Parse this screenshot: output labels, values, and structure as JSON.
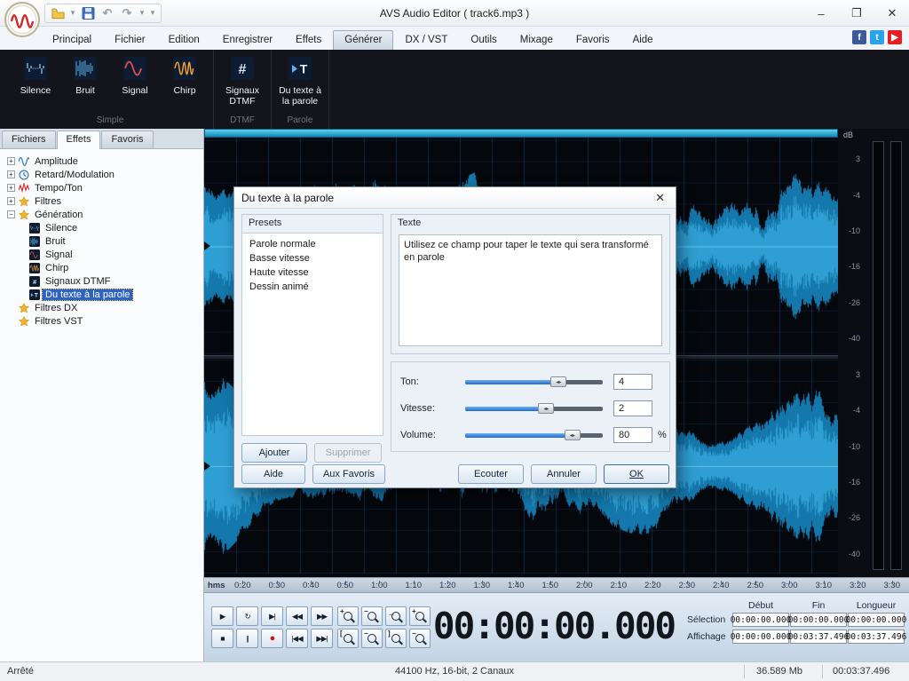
{
  "window": {
    "title": "AVS Audio Editor  ( track6.mp3 )",
    "minimize": "–",
    "maximize": "❐",
    "close": "✕"
  },
  "quick_access": [
    {
      "name": "open-file",
      "icon": "folder"
    },
    {
      "name": "open-file-dropdown",
      "icon": "chevron"
    },
    {
      "name": "save",
      "icon": "floppy"
    },
    {
      "name": "undo",
      "icon": "undo"
    },
    {
      "name": "redo",
      "icon": "redo"
    },
    {
      "name": "redo-dropdown",
      "icon": "chevron"
    },
    {
      "name": "customize-toolbar",
      "icon": "chevron"
    }
  ],
  "ribbon": {
    "tabs": [
      "Principal",
      "Fichier",
      "Edition",
      "Enregistrer",
      "Effets",
      "Générer",
      "DX / VST",
      "Outils",
      "Mixage",
      "Favoris",
      "Aide"
    ],
    "active_tab": "Générer",
    "groups": [
      {
        "label": "Simple",
        "buttons": [
          {
            "label": "Silence",
            "icon": "silence"
          },
          {
            "label": "Bruit",
            "icon": "noise"
          },
          {
            "label": "Signal",
            "icon": "signal"
          },
          {
            "label": "Chirp",
            "icon": "chirp"
          }
        ]
      },
      {
        "label": "DTMF",
        "buttons": [
          {
            "label": "Signaux DTMF",
            "icon": "dtmf"
          }
        ]
      },
      {
        "label": "Parole",
        "buttons": [
          {
            "label": "Du texte à la parole",
            "icon": "tts"
          }
        ]
      }
    ]
  },
  "social": [
    {
      "name": "facebook",
      "glyph": "f",
      "color": "#3a5a98"
    },
    {
      "name": "twitter",
      "glyph": "t",
      "color": "#2aa3ef"
    },
    {
      "name": "youtube",
      "glyph": "▶",
      "color": "#e32020"
    }
  ],
  "left_panel": {
    "tabs": [
      "Fichiers",
      "Effets",
      "Favoris"
    ],
    "active_tab": "Effets",
    "tree": [
      {
        "label": "Amplitude",
        "icon": "amp",
        "expand": "+"
      },
      {
        "label": "Retard/Modulation",
        "icon": "clock",
        "expand": "+"
      },
      {
        "label": "Tempo/Ton",
        "icon": "tempo",
        "expand": "+"
      },
      {
        "label": "Filtres",
        "icon": "star",
        "expand": "+"
      },
      {
        "label": "Génération",
        "icon": "star",
        "expand": "−",
        "children": [
          {
            "label": "Silence",
            "icon": "silence"
          },
          {
            "label": "Bruit",
            "icon": "noise"
          },
          {
            "label": "Signal",
            "icon": "signal"
          },
          {
            "label": "Chirp",
            "icon": "chirp"
          },
          {
            "label": "Signaux DTMF",
            "icon": "dtmf"
          },
          {
            "label": "Du texte à la parole",
            "icon": "tts",
            "selected": true
          }
        ]
      },
      {
        "label": "Filtres DX",
        "icon": "star"
      },
      {
        "label": "Filtres VST",
        "icon": "star"
      }
    ]
  },
  "dialog": {
    "title": "Du texte à la parole",
    "close": "✕",
    "presets_label": "Presets",
    "presets": [
      "Parole normale",
      "Basse vitesse",
      "Haute vitesse",
      "Dessin animé"
    ],
    "add_button": "Ajouter",
    "remove_button": "Supprimer",
    "text_group_label": "Texte",
    "text_value": "Utilisez ce champ pour taper le texte qui sera transformé en parole",
    "sliders": [
      {
        "label": "Ton:",
        "value": "4",
        "percent": 68
      },
      {
        "label": "Vitesse:",
        "value": "2",
        "percent": 59
      },
      {
        "label": "Volume:",
        "value": "80",
        "percent": 78,
        "suffix": "%"
      }
    ],
    "help_button": "Aide",
    "favorites_button": "Aux Favoris",
    "listen_button": "Ecouter",
    "cancel_button": "Annuler",
    "ok_button": "OK"
  },
  "meters": {
    "db": "dB",
    "scale_sections": [
      [
        "3",
        "-4",
        "-10",
        "-16",
        "-26",
        "-40"
      ],
      [
        "3",
        "-4",
        "-10",
        "-16",
        "-26",
        "-40"
      ]
    ]
  },
  "timeline": {
    "unit": "hms",
    "ticks": [
      "0:20",
      "0:30",
      "0:40",
      "0:50",
      "1:00",
      "1:10",
      "1:20",
      "1:30",
      "1:40",
      "1:50",
      "2:00",
      "2:10",
      "2:20",
      "2:30",
      "2:40",
      "2:50",
      "3:00",
      "3:10",
      "3:20",
      "3:30"
    ]
  },
  "transport": [
    [
      {
        "name": "play",
        "glyph": "▶"
      },
      {
        "name": "loop",
        "glyph": "↻"
      },
      {
        "name": "play-to-end",
        "glyph": "▶|"
      },
      {
        "name": "rewind",
        "glyph": "◀◀"
      },
      {
        "name": "fast-forward",
        "glyph": "▶▶"
      }
    ],
    [
      {
        "name": "stop",
        "glyph": "■"
      },
      {
        "name": "pause",
        "glyph": "||"
      },
      {
        "name": "record",
        "glyph": "●",
        "record": true
      },
      {
        "name": "go-to-start",
        "glyph": "|◀◀"
      },
      {
        "name": "go-to-end",
        "glyph": "▶▶|"
      }
    ]
  ],
  "zoom": [
    [
      {
        "name": "zoom-in",
        "mod": "+"
      },
      {
        "name": "zoom-out",
        "mod": "−"
      },
      {
        "name": "zoom-fit",
        "mod": "﹍"
      },
      {
        "name": "zoom-vertical-in",
        "mod": "+"
      }
    ],
    [
      {
        "name": "zoom-selection-left",
        "mod": "["
      },
      {
        "name": "zoom-out-full",
        "mod": "−"
      },
      {
        "name": "zoom-selection-right",
        "mod": "]"
      },
      {
        "name": "zoom-vertical-out",
        "mod": "−"
      }
    ]
  ],
  "time_display": "00:00:00.000",
  "selection_panel": {
    "headers": [
      "Début",
      "Fin",
      "Longueur"
    ],
    "rows": [
      {
        "label": "Sélection",
        "values": [
          "00:00:00.000",
          "00:00:00.000",
          "00:00:00.000"
        ]
      },
      {
        "label": "Affichage",
        "values": [
          "00:00:00.000",
          "00:03:37.496",
          "00:03:37.496"
        ]
      }
    ]
  },
  "status_bar": {
    "state": "Arrêté",
    "format": "44100 Hz, 16-bit, 2 Canaux",
    "size": "36.589 Mb",
    "length": "00:03:37.496"
  }
}
